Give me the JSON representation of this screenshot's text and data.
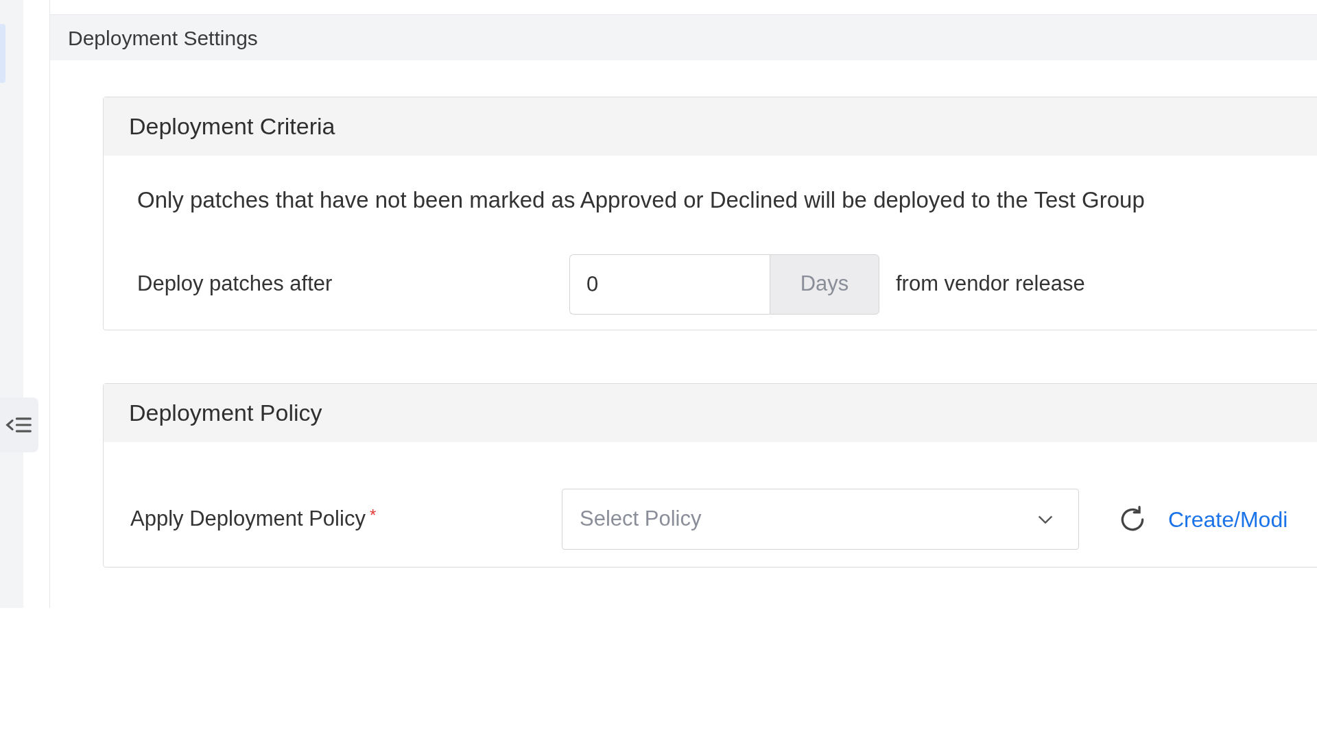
{
  "section": {
    "title": "Deployment Settings"
  },
  "criteria": {
    "title": "Deployment Criteria",
    "note": "Only patches that have not been marked as Approved or Declined will be deployed to the Test Group",
    "label": "Deploy patches after",
    "value": "0",
    "unit": "Days",
    "suffix": "from vendor release"
  },
  "policy": {
    "title": "Deployment Policy",
    "label": "Apply Deployment Policy",
    "required": true,
    "required_mark": "*",
    "placeholder": "Select Policy",
    "link": "Create/Modi"
  }
}
